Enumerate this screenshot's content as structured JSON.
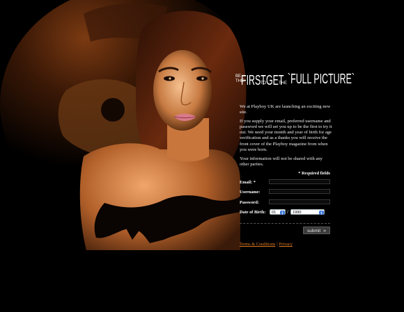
{
  "headline": {
    "be": "BE",
    "the1": "THE",
    "first": "FIRST",
    "to": "TO",
    "get": "GET",
    "the2": "THE",
    "full_picture": "`FULL PICTURE`"
  },
  "intro": {
    "p1": "We at Playboy UK are launching an exciting new site.",
    "p2": "If you supply your email, preferred username and password we will set you up to be the first to try it out. We need your month and year of birth for age verification and as a thanks you will receive the front cover of the Playboy magazine from when you were born.",
    "p3": "Your information will not be shared with any other parties."
  },
  "form": {
    "required_note": "* Required fields",
    "email_label": "Email: *",
    "email_value": "",
    "username_label": "Username:",
    "username_value": "",
    "password_label": "Password:",
    "password_value": "",
    "dob_label": "Date of Birth:",
    "dob_month": "01",
    "dob_separator": "/",
    "dob_year": "1990",
    "submit_label": "submit",
    "submit_icon": "double-chevron-right-icon"
  },
  "footer": {
    "terms": "Terms & Conditions",
    "separator": "|",
    "privacy": "Privacy"
  },
  "colors": {
    "background": "#000000",
    "link": "#e07a22",
    "accent_select": "#3d78d8",
    "button": "#3b3b3b"
  }
}
